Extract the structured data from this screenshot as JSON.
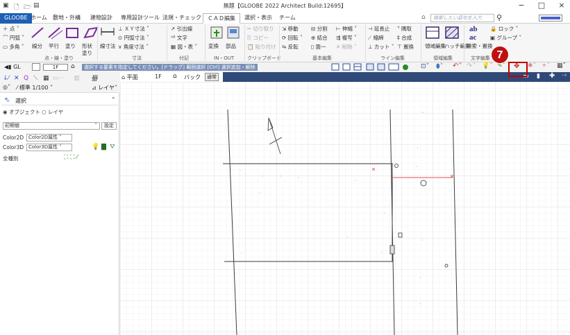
{
  "window": {
    "title": "無題【GLOOBE 2022 Architect Build:12695】",
    "controls": [
      "−",
      "□",
      "×"
    ]
  },
  "tabs": [
    "GLOOBE",
    "ホーム",
    "敷地・外構",
    "建物設計",
    "専用設計ツール",
    "法規・チェック",
    "ＣＡＤ編集",
    "選択・表示",
    "チーム"
  ],
  "search": {
    "placeholder": "検索したい語句を入力"
  },
  "ribbon": {
    "draw": {
      "point": "点",
      "arc": "円弧",
      "poly": "多角",
      "segment": "線分",
      "parallel": "平行",
      "fill": "塗り",
      "shape_fill": "形状",
      "shape_fill2": "塗り",
      "label": "点・線・塗り"
    },
    "dim": {
      "dim": "線寸法",
      "xy": "ＸＹ寸法",
      "arc": "円弧寸法",
      "angle": "角度寸法",
      "label": "寸法"
    },
    "note": {
      "leader": "引出線",
      "text": "文字",
      "figure": "図・表",
      "label": "付記"
    },
    "io": {
      "convert": "変換",
      "parts": "部品",
      "label": "IN・OUT"
    },
    "clip": {
      "cut": "切り取り",
      "copy": "コピー",
      "paste": "貼り付け",
      "label": "クリップボード"
    },
    "edit": {
      "move": "移動",
      "rotate": "回転",
      "mirror": "反転",
      "split": "分割",
      "join": "結合",
      "face": "面一",
      "stretch": "伸縮",
      "copy_multi": "複写",
      "delete": "削除",
      "label": "基本編集"
    },
    "line": {
      "extend": "延長止",
      "offset": "縮締",
      "cut": "カット",
      "chamfer": "隅取",
      "merge": "合成",
      "replace": "置換",
      "label": "ライン編集"
    },
    "area": {
      "edit": "領域編集",
      "hatch": "ハッチ編集",
      "label": "領域編集"
    },
    "text": {
      "search": "検索・置換",
      "label": "文字編集"
    },
    "other": {
      "lock": "ロック",
      "group": "グループ"
    }
  },
  "doc_toolbar": {
    "gl": "GL",
    "floor": "1F",
    "hint": "選択する要素を指定してください。[ドラッグ] 範囲選択 [Ctrl] 選択追加・解除"
  },
  "layer_bar": {
    "scale": "標準 1/100",
    "layer": "レイヤ"
  },
  "left_panel": {
    "select_title": "選択",
    "radio_object": "オブジェクト",
    "radio_layer": "レイヤ",
    "preset": "初期値",
    "settings_button": "設定",
    "color2d_label": "Color2D",
    "color2d_value": "Color2D属性",
    "color3d_label": "Color3D",
    "color3d_value": "Color3D属性",
    "all_types": "全種別"
  },
  "view_tabs": {
    "plan": "平面",
    "floor": "1F",
    "back": "バック",
    "normal": "通常"
  },
  "annotation": {
    "step": "7"
  },
  "accent": {
    "file_tab": "#1e5fb4",
    "highlight": "#c00000",
    "view_bar": "#2f4a78"
  }
}
